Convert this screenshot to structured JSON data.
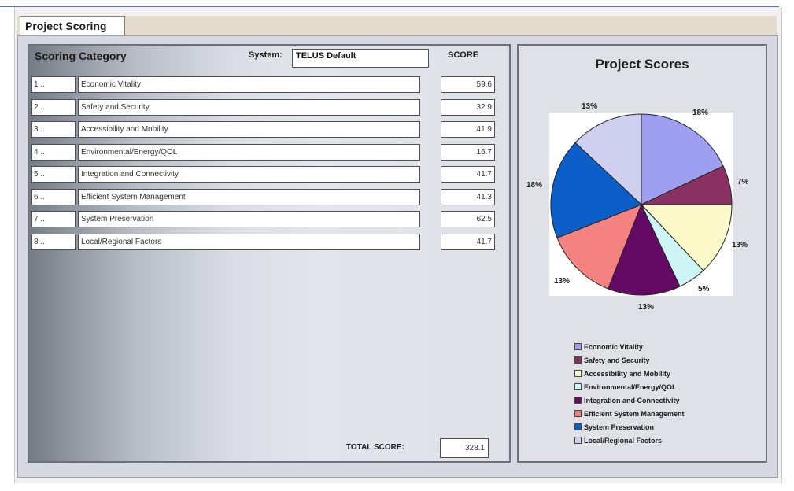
{
  "tab": {
    "label": "Project Scoring"
  },
  "header": {
    "category_label": "Scoring Category",
    "system_label": "System:",
    "system_value": "TELUS Default",
    "score_label": "SCORE"
  },
  "rows": [
    {
      "num": "1 ..",
      "category": "Economic Vitality",
      "score": "59.6"
    },
    {
      "num": "2 ..",
      "category": "Safety and Security",
      "score": "32.9"
    },
    {
      "num": "3 ..",
      "category": "Accessibility and Mobility",
      "score": "41.9"
    },
    {
      "num": "4 ..",
      "category": "Environmental/Energy/QOL",
      "score": "16.7"
    },
    {
      "num": "5 ..",
      "category": "Integration and Connectivity",
      "score": "41.7"
    },
    {
      "num": "6 ..",
      "category": "Efficient System Management",
      "score": "41.3"
    },
    {
      "num": "7 ..",
      "category": "System Preservation",
      "score": "62.5"
    },
    {
      "num": "8 ..",
      "category": "Local/Regional Factors",
      "score": "41.7"
    }
  ],
  "total": {
    "label": "TOTAL SCORE:",
    "value": "328.1"
  },
  "chart_data": {
    "type": "pie",
    "title": "Project Scores",
    "slices": [
      {
        "name": "Economic Vitality",
        "percent": 18,
        "label": "18%",
        "color": "#9f9ff2"
      },
      {
        "name": "Safety and Security",
        "percent": 7,
        "label": "7%",
        "color": "#8a3163"
      },
      {
        "name": "Accessibility and Mobility",
        "percent": 13,
        "label": "13%",
        "color": "#fbfac8"
      },
      {
        "name": "Environmental/Energy/QOL",
        "percent": 5,
        "label": "5%",
        "color": "#cdf5f6"
      },
      {
        "name": "Integration and Connectivity",
        "percent": 13,
        "label": "13%",
        "color": "#640a64"
      },
      {
        "name": "Efficient System Management",
        "percent": 13,
        "label": "13%",
        "color": "#f48280"
      },
      {
        "name": "System Preservation",
        "percent": 18,
        "label": "18%",
        "color": "#0c5fc8"
      },
      {
        "name": "Local/Regional Factors",
        "percent": 13,
        "label": "13%",
        "color": "#cfcfef"
      }
    ],
    "legend_items": [
      "Economic Vitality",
      "Safety and Security",
      "Accessibility and Mobility",
      "Environmental/Energy/QOL",
      "Integration and Connectivity",
      "Efficient System Management",
      "System Preservation",
      "Local/Regional Factors"
    ],
    "legend_placement": "bottom"
  }
}
